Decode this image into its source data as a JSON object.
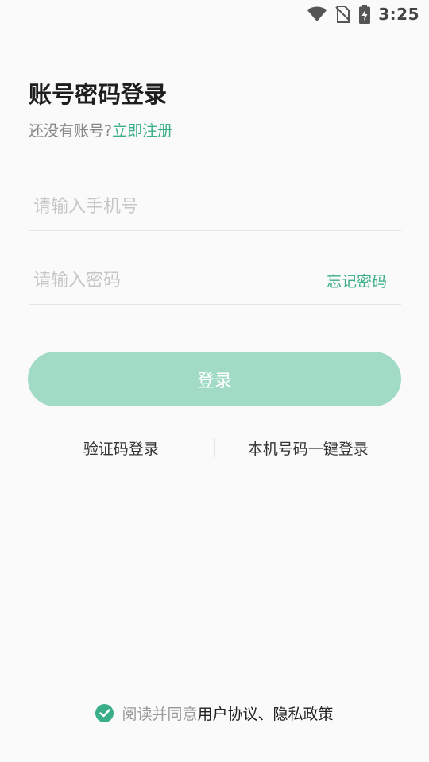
{
  "status_bar": {
    "time": "3:25",
    "icons": [
      "wifi-icon",
      "no-sim-icon",
      "battery-charging-icon"
    ]
  },
  "header": {
    "title": "账号密码登录",
    "subtitle_prefix": "还没有账号?",
    "register_link": "立即注册"
  },
  "form": {
    "phone_placeholder": "请输入手机号",
    "phone_value": "",
    "password_placeholder": "请输入密码",
    "password_value": "",
    "forgot_password": "忘记密码",
    "login_button": "登录"
  },
  "alt_logins": {
    "sms_login": "验证码登录",
    "one_click_login": "本机号码一键登录"
  },
  "agreement": {
    "checked": true,
    "prefix": "阅读并同意",
    "links": "用户协议、隐私政策"
  },
  "colors": {
    "accent": "#3aae8a",
    "button_bg": "#a1dbc6",
    "background": "#fafafa"
  }
}
